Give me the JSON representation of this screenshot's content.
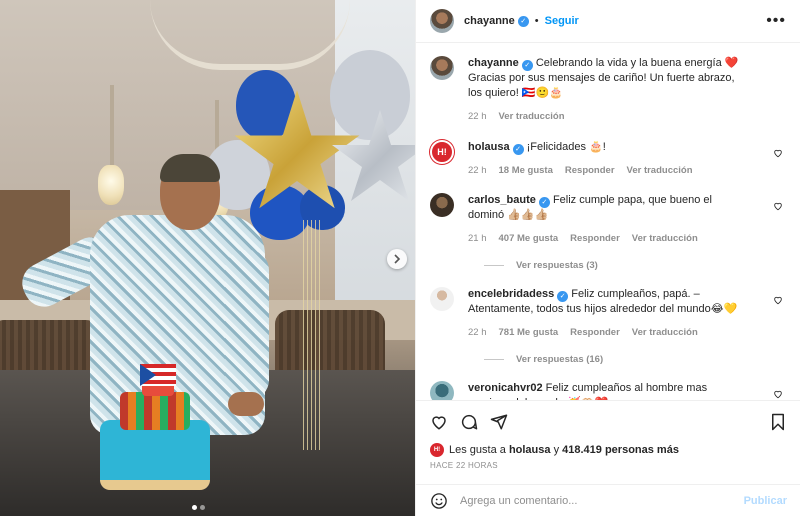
{
  "post": {
    "author": "chayanne",
    "follow_label": "Seguir",
    "separator": "•",
    "more_label": "•••"
  },
  "caption": {
    "username": "chayanne",
    "text": "Celebrando la vida y la buena energía ❤️Gracias por sus mensajes de cariño! Un fuerte abrazo, los quiero! 🇵🇷🙂🎂",
    "time": "22 h",
    "translate": "Ver traducción"
  },
  "comments": [
    {
      "username": "holausa",
      "avatar_text": "H!",
      "text": "¡Felicidades 🎂!",
      "time": "22 h",
      "likes": "18 Me gusta",
      "reply": "Responder",
      "translate": "Ver traducción"
    },
    {
      "username": "carlos_baute",
      "text": "Feliz cumple papa, que bueno el dominó 👍🏼👍🏼👍🏼",
      "time": "21 h",
      "likes": "407 Me gusta",
      "reply": "Responder",
      "translate": "Ver traducción",
      "replies": "Ver respuestas (3)"
    },
    {
      "username": "encelebridadess",
      "text": "Feliz cumpleaños, papá. –Atentamente, todos tus hijos alrededor del mundo😂💛",
      "time": "22 h",
      "likes": "781 Me gusta",
      "reply": "Responder",
      "translate": "Ver traducción",
      "replies": "Ver respuestas (16)"
    },
    {
      "username": "veronicahvr02",
      "text": "Feliz cumpleaños al hombre mas precioso del mundo 🥳🫶🏻❤️"
    }
  ],
  "likes": {
    "prefix": "Les gusta a",
    "user": "holausa",
    "mid": "y",
    "count": "418.419 personas más",
    "avatar_text": "H!"
  },
  "timestamp": "HACE 22 HORAS",
  "comment_box": {
    "placeholder": "Agrega un comentario...",
    "post_label": "Publicar"
  },
  "icons": {
    "verified": "verified-badge-icon",
    "more": "more-options-icon",
    "heart": "heart-icon",
    "comment": "comment-icon",
    "share": "share-icon",
    "save": "bookmark-icon",
    "emoji": "emoji-icon",
    "next": "chevron-right-icon"
  },
  "colors": {
    "accent": "#0095f6",
    "verified": "#3897f0",
    "muted": "#8e8e8e",
    "hola_red": "#d9272e"
  }
}
